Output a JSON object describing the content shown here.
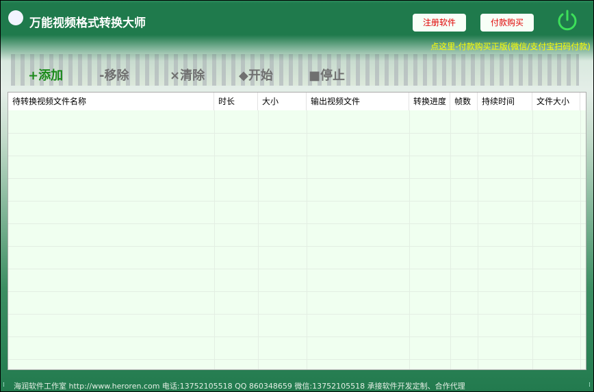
{
  "app": {
    "title": "万能视频格式转换大师"
  },
  "header": {
    "register_label": "注册软件",
    "buy_label": "付款购买",
    "promo": "点这里-付款购买正版(微信/支付宝扫码付款)"
  },
  "toolbar": {
    "add": "+添加",
    "remove": "-移除",
    "clear": "×清除",
    "start": "◆开始",
    "stop": "■停止"
  },
  "table": {
    "columns": [
      "待转换视频文件名称",
      "时长",
      "大小",
      "输出视频文件",
      "转换进度",
      "帧数",
      "持续时间",
      "文件大小"
    ],
    "rows": []
  },
  "status": {
    "text": "海润软件工作室 http://www.heroren.com  电话:13752105518  QQ 860348659 微信:13752105518  承接软件开发定制、合作代理"
  },
  "colors": {
    "accent": "#1f7a4c",
    "add": "#1a8a1a",
    "promo": "#ffff00"
  }
}
